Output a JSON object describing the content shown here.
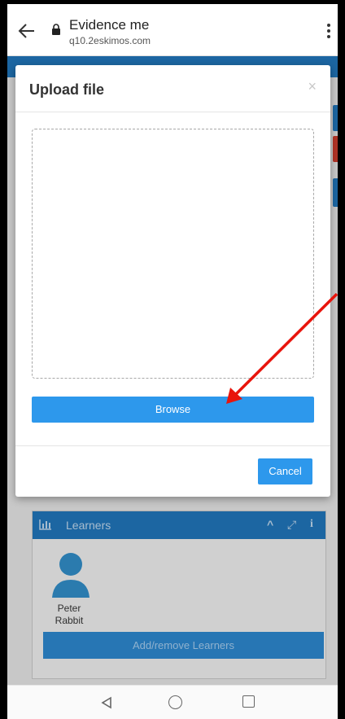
{
  "browser": {
    "title": "Evidence me",
    "url": "q10.2eskimos.com"
  },
  "modal": {
    "title": "Upload file",
    "close_glyph": "×",
    "browse_label": "Browse",
    "cancel_label": "Cancel"
  },
  "learners_panel": {
    "title": "Learners",
    "learner_name": "Peter Rabbit",
    "add_remove_label": "Add/remove Learners",
    "collapse_glyph": "^",
    "expand_glyph": "⤢",
    "info_glyph": "i"
  },
  "colors": {
    "accent": "#2d98ec",
    "header_blue": "#1f6fb0",
    "annotation_red": "#e8140c"
  },
  "icons": [
    "back-arrow-icon",
    "lock-icon",
    "more-vert-icon",
    "close-icon",
    "bar-chart-icon",
    "chevron-up-icon",
    "expand-icon",
    "info-icon",
    "avatar-icon",
    "nav-back-icon",
    "nav-home-icon",
    "nav-recents-icon"
  ]
}
